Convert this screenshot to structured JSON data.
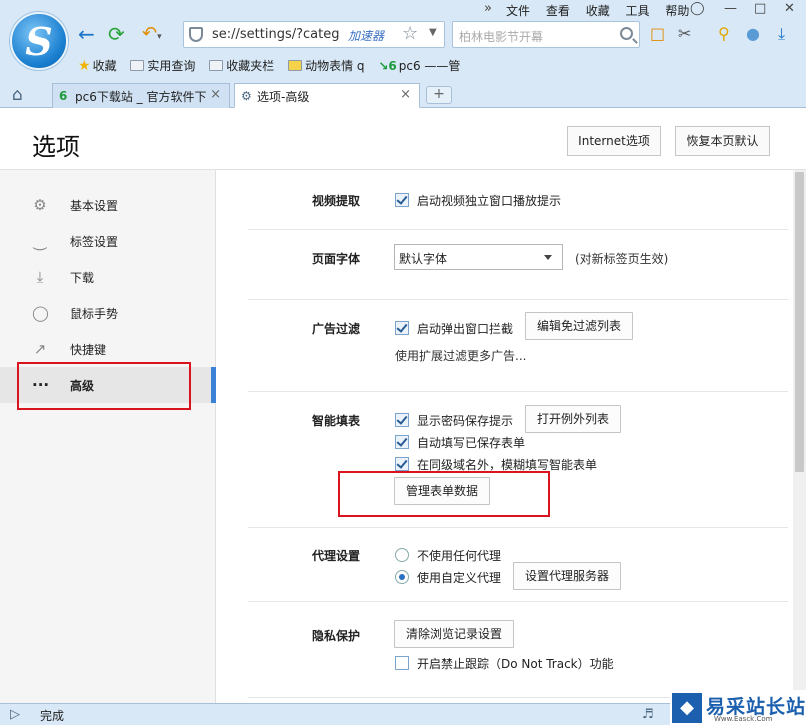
{
  "browser": {
    "address": "se://settings/?categ",
    "accelerator": "加速器",
    "search_placeholder": "柏林电影节开幕",
    "menu": [
      "文件",
      "查看",
      "收藏",
      "工具",
      "帮助"
    ],
    "bookmarks": [
      "收藏",
      "实用查询",
      "收藏夹栏",
      "动物表情 q",
      "pc6 ——管"
    ],
    "tabs": [
      {
        "title": "pc6下载站 _ 官方软件下"
      },
      {
        "title": "选项-高级"
      }
    ]
  },
  "page": {
    "title": "选项",
    "internet_options_button": "Internet选项",
    "restore_defaults_button": "恢复本页默认"
  },
  "sidebar": {
    "items": [
      {
        "label": "基本设置",
        "icon": "gear-icon"
      },
      {
        "label": "标签设置",
        "icon": "tab-icon"
      },
      {
        "label": "下载",
        "icon": "download-icon"
      },
      {
        "label": "鼠标手势",
        "icon": "mouse-icon"
      },
      {
        "label": "快捷键",
        "icon": "shortcut-icon"
      },
      {
        "label": "高级",
        "icon": "more-icon",
        "active": true
      }
    ],
    "active_icon_glyph": "···"
  },
  "settings": {
    "video": {
      "label": "视频提取",
      "option": "启动视频独立窗口播放提示",
      "checked": true
    },
    "font": {
      "label": "页面字体",
      "selected": "默认字体",
      "hint": "(对新标签页生效)"
    },
    "adblock": {
      "label": "广告过滤",
      "option": "启动弹出窗口拦截",
      "checked": true,
      "button": "编辑免过滤列表",
      "hint": "使用扩展过滤更多广告..."
    },
    "autofill": {
      "label": "智能填表",
      "options": [
        {
          "text": "显示密码保存提示",
          "checked": true
        },
        {
          "text": "自动填写已保存表单",
          "checked": true
        },
        {
          "text": "在同级域名外，模糊填写智能表单",
          "checked": true
        }
      ],
      "exceptions_button": "打开例外列表",
      "manage_button": "管理表单数据"
    },
    "proxy": {
      "label": "代理设置",
      "options": [
        {
          "text": "不使用任何代理",
          "selected": false
        },
        {
          "text": "使用自定义代理",
          "selected": true
        }
      ],
      "button": "设置代理服务器"
    },
    "privacy": {
      "label": "隐私保护",
      "button": "清除浏览记录设置",
      "option": "开启禁止跟踪（Do Not Track）功能",
      "checked": false
    }
  },
  "status": {
    "text": "完成"
  },
  "watermark": {
    "title": "易采站长站",
    "url": "Www.Easck.Com"
  },
  "colors": {
    "accent": "#3b82d6",
    "highlight": "#d9141c",
    "chrome": "#d8e8f6"
  }
}
